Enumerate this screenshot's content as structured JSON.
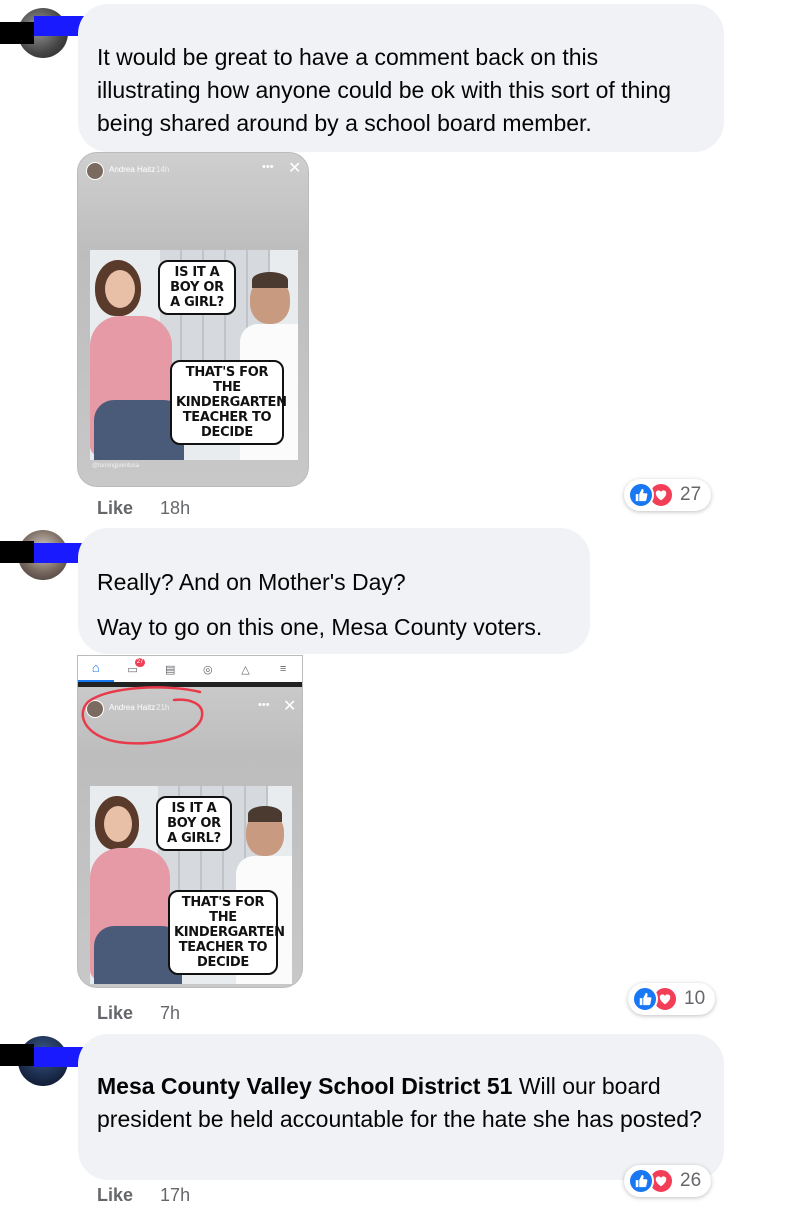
{
  "comments": [
    {
      "text": "It would be great to have a comment back on this illustrating how anyone could be ok with this sort of thing being shared around by a school board member.",
      "like_label": "Like",
      "time": "18h",
      "reaction_count": "27",
      "story": {
        "author": "Andrea Haitz",
        "age": "14h",
        "meme_top": "IS IT A BOY OR A GIRL?",
        "meme_bottom": "THAT'S FOR THE KINDERGARTEN TEACHER TO DECIDE",
        "watermark": "@turningpointusa"
      }
    },
    {
      "text_line1": "Really? And on Mother's Day?",
      "text_line2": "Way to go on this one, Mesa County voters.",
      "like_label": "Like",
      "time": "7h",
      "reaction_count": "10",
      "story": {
        "author": "Andrea Haitz",
        "age": "21h",
        "meme_top": "IS IT A BOY OR A GIRL?",
        "meme_bottom": "THAT'S FOR THE KINDERGARTEN TEACHER TO DECIDE",
        "nav_badge": "27"
      }
    },
    {
      "tag": "Mesa County Valley School District 51",
      "text": "Will our board president be held accountable for the hate she has posted?",
      "like_label": "Like",
      "time": "17h",
      "reaction_count": "26"
    }
  ],
  "colors": {
    "like_blue": "#1877f2",
    "love_red": "#f33e58",
    "bubble_gray": "#f0f2f5",
    "redaction_blue": "#1a1aff",
    "circle_red": "#e83a4a"
  },
  "icons": [
    "like-icon",
    "love-icon",
    "home-icon",
    "video-icon",
    "marketplace-icon",
    "groups-icon",
    "bell-icon",
    "menu-icon"
  ]
}
